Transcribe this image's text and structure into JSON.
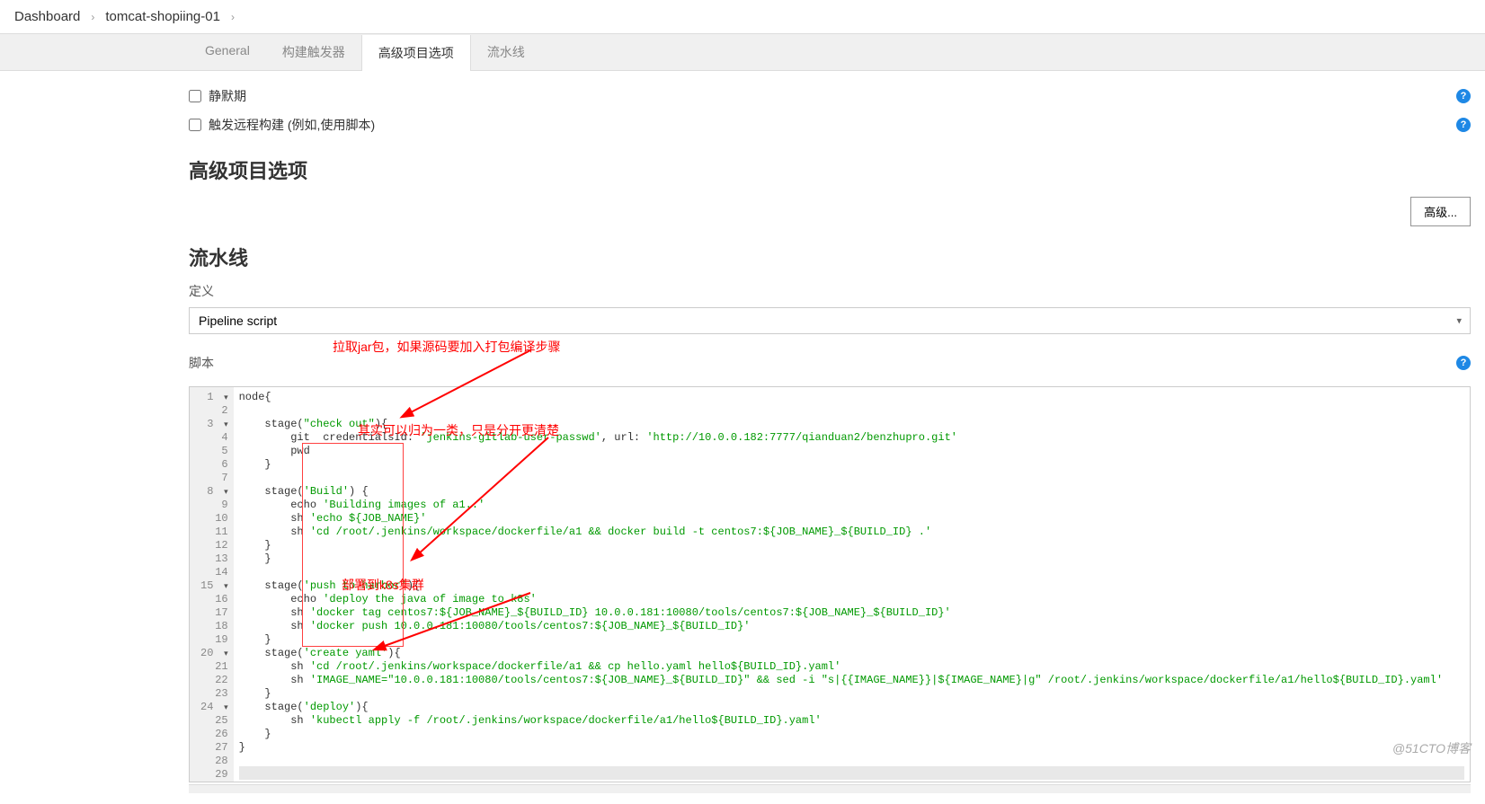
{
  "breadcrumb": {
    "items": [
      "Dashboard",
      "tomcat-shopiing-01"
    ]
  },
  "tabs": [
    {
      "label": "General",
      "active": false
    },
    {
      "label": "构建触发器",
      "active": false
    },
    {
      "label": "高级项目选项",
      "active": true
    },
    {
      "label": "流水线",
      "active": false
    }
  ],
  "checkboxes": {
    "quiet_period": "静默期",
    "remote_trigger": "触发远程构建 (例如,使用脚本)"
  },
  "sections": {
    "advanced_title": "高级项目选项",
    "pipeline_title": "流水线"
  },
  "buttons": {
    "advanced": "高级..."
  },
  "labels": {
    "definition": "定义",
    "script": "脚本"
  },
  "select": {
    "value": "Pipeline script"
  },
  "annotations": {
    "a1": "拉取jar包，如果源码要加入打包编译步骤",
    "a2": "其实可以归为一类，只是分开更清楚",
    "a3": "部署到k8s集群"
  },
  "editor": {
    "lines": [
      {
        "n": 1,
        "fold": "▾",
        "raw": "node{"
      },
      {
        "n": 2,
        "raw": ""
      },
      {
        "n": 3,
        "fold": "▾",
        "raw": "    stage(\"check out\"){"
      },
      {
        "n": 4,
        "raw": "        git  credentialsId: 'jenkins-gitlab-user-passwd', url: 'http://10.0.0.182:7777/qianduan2/benzhupro.git'"
      },
      {
        "n": 5,
        "raw": "        pwd"
      },
      {
        "n": 6,
        "raw": "    }"
      },
      {
        "n": 7,
        "raw": ""
      },
      {
        "n": 8,
        "fold": "▾",
        "raw": "    stage('Build') {"
      },
      {
        "n": 9,
        "raw": "        echo 'Building images of a1..'"
      },
      {
        "n": 10,
        "raw": "        sh 'echo ${JOB_NAME}'"
      },
      {
        "n": 11,
        "raw": "        sh 'cd /root/.jenkins/workspace/dockerfile/a1 && docker build -t centos7:${JOB_NAME}_${BUILD_ID} .'"
      },
      {
        "n": 12,
        "raw": "    }"
      },
      {
        "n": 13,
        "raw": "    }"
      },
      {
        "n": 14,
        "raw": ""
      },
      {
        "n": 15,
        "fold": "▾",
        "raw": "    stage('push to harbor'){"
      },
      {
        "n": 16,
        "raw": "        echo 'deploy the java of image to k8s'"
      },
      {
        "n": 17,
        "raw": "        sh 'docker tag centos7:${JOB_NAME}_${BUILD_ID} 10.0.0.181:10080/tools/centos7:${JOB_NAME}_${BUILD_ID}'"
      },
      {
        "n": 18,
        "raw": "        sh 'docker push 10.0.0.181:10080/tools/centos7:${JOB_NAME}_${BUILD_ID}'"
      },
      {
        "n": 19,
        "raw": "    }"
      },
      {
        "n": 20,
        "fold": "▾",
        "raw": "    stage('create yaml'){"
      },
      {
        "n": 21,
        "raw": "        sh 'cd /root/.jenkins/workspace/dockerfile/a1 && cp hello.yaml hello${BUILD_ID}.yaml'"
      },
      {
        "n": 22,
        "raw": "        sh 'IMAGE_NAME=\"10.0.0.181:10080/tools/centos7:${JOB_NAME}_${BUILD_ID}\" && sed -i \"s|{{IMAGE_NAME}}|${IMAGE_NAME}|g\" /root/.jenkins/workspace/dockerfile/a1/hello${BUILD_ID}.yaml'"
      },
      {
        "n": 23,
        "raw": "    }"
      },
      {
        "n": 24,
        "fold": "▾",
        "raw": "    stage('deploy'){"
      },
      {
        "n": 25,
        "raw": "        sh 'kubectl apply -f /root/.jenkins/workspace/dockerfile/a1/hello${BUILD_ID}.yaml'"
      },
      {
        "n": 26,
        "raw": "    }"
      },
      {
        "n": 27,
        "raw": "}"
      },
      {
        "n": 28,
        "raw": ""
      },
      {
        "n": 29,
        "raw": "",
        "active": true
      }
    ]
  },
  "watermark": "@51CTO博客"
}
